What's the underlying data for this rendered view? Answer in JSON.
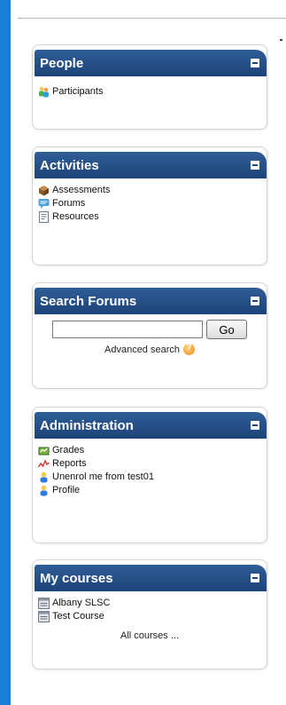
{
  "blocks": {
    "people": {
      "title": "People",
      "items": [
        {
          "label": "Participants",
          "icon": "participants-icon"
        }
      ]
    },
    "activities": {
      "title": "Activities",
      "items": [
        {
          "label": "Assessments",
          "icon": "assessments-icon"
        },
        {
          "label": "Forums",
          "icon": "forums-icon"
        },
        {
          "label": "Resources",
          "icon": "resources-icon"
        }
      ]
    },
    "search_forums": {
      "title": "Search Forums",
      "search_value": "",
      "go_label": "Go",
      "advanced_label": "Advanced search"
    },
    "administration": {
      "title": "Administration",
      "items": [
        {
          "label": "Grades",
          "icon": "grades-icon"
        },
        {
          "label": "Reports",
          "icon": "reports-icon"
        },
        {
          "label": "Unenrol me from test01",
          "icon": "unenrol-icon"
        },
        {
          "label": "Profile",
          "icon": "profile-icon"
        }
      ]
    },
    "my_courses": {
      "title": "My courses",
      "items": [
        {
          "label": "Albany SLSC",
          "icon": "course-icon"
        },
        {
          "label": "Test Course",
          "icon": "course-icon"
        }
      ],
      "all_courses_label": "All courses ..."
    }
  },
  "colors": {
    "header_blue": "#2f5d96",
    "left_rail_blue": "#1a7fd6"
  }
}
